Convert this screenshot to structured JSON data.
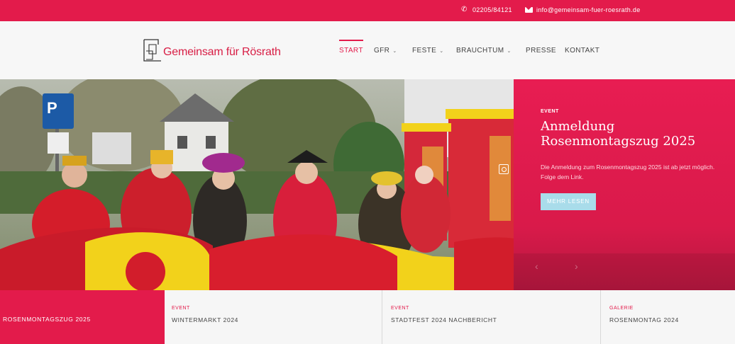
{
  "topbar": {
    "phone": "02205/84121",
    "email": "info@gemeinsam-fuer-roesrath.de"
  },
  "logo": {
    "text": "Gemeinsam für Rösrath"
  },
  "nav": {
    "items": [
      {
        "label": "START"
      },
      {
        "label": "GFR"
      },
      {
        "label": "FESTE"
      },
      {
        "label": "BRAUCHTUM"
      },
      {
        "label": "PRESSE"
      },
      {
        "label": "KONTAKT"
      }
    ]
  },
  "hero": {
    "tag": "EVENT",
    "title": "Anmeldung Rosenmontagszug 2025",
    "description": "Die Anmeldung zum Rosenmontagszug 2025 ist ab jetzt möglich. Folge dem Link.",
    "button": "MEHR LESEN"
  },
  "bottom": {
    "tiles": [
      {
        "category": "",
        "name": "ROSENMONTAGSZUG 2025"
      },
      {
        "category": "EVENT",
        "name": "WINTERMARKT 2024"
      },
      {
        "category": "EVENT",
        "name": "STADTFEST 2024 NACHBERICHT"
      },
      {
        "category": "GALERIE",
        "name": "ROSENMONTAG 2024"
      }
    ]
  },
  "colors": {
    "brand": "#e31b4b",
    "button": "#a9dcea"
  },
  "icons": [
    "phone-icon",
    "mail-icon",
    "logo-mark",
    "fullscreen-icon",
    "chevron-down-icon",
    "arrow-left-icon",
    "arrow-right-icon"
  ]
}
